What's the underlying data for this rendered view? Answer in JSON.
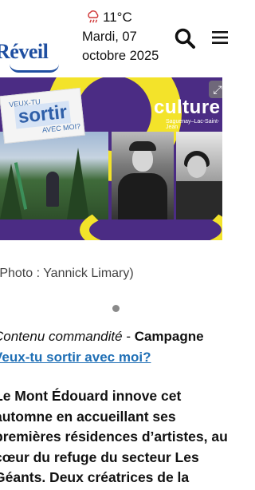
{
  "header": {
    "logo_text": "Réveil",
    "temperature": "11°C",
    "weather_icon": "rain-cloud-icon",
    "date_line1": "Mardi, 07",
    "date_line2": "octobre 2025"
  },
  "hero": {
    "sticker_top": "VEUX-TU",
    "sticker_main": "sortir",
    "sticker_bottom": "AVEC MOI?",
    "brand": "culture",
    "region": "Saguenay–Lac-Saint-Jean",
    "colors": {
      "purple": "#4b2c84",
      "yellow": "#f3e32a",
      "blue": "#2f5fa8"
    }
  },
  "credit": "(Photo : Yannick Limary)",
  "carousel": {
    "dots": 1,
    "active": 1
  },
  "sponsor": {
    "prefix": "Contenu commandité",
    "separator": " - ",
    "label": "Campagne",
    "link": "Veux-tu sortir avec moi?"
  },
  "article": {
    "lines": [
      "Le Mont Édouard innove cet",
      "automne en accueillant ses",
      "premières résidences d’artistes, au",
      "cœur du refuge du secteur Les",
      "Géants. Deux créatrices de la"
    ]
  }
}
